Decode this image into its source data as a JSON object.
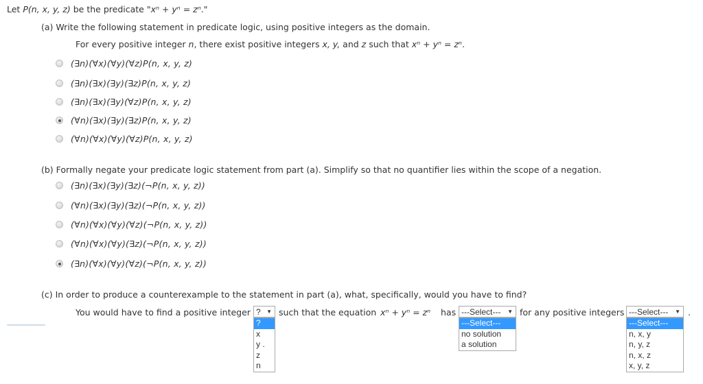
{
  "intro": {
    "prefix": "Let ",
    "predicate": "P(n, x, y, z)",
    "middle": " be the predicate  \"",
    "equation": "xⁿ + yⁿ = zⁿ",
    "suffix": ".\""
  },
  "part_a": {
    "prompt": "(a) Write the following statement in predicate logic, using positive integers as the domain.",
    "statement_prefix": "For every positive integer ",
    "statement_n": "n",
    "statement_mid": ", there exist positive integers ",
    "statement_vars": "x, y,",
    "statement_and": " and ",
    "statement_z": "z",
    "statement_such": " such that  ",
    "statement_eq": "xⁿ + yⁿ = zⁿ",
    "statement_end": ".",
    "options": [
      {
        "text": "(∃n)(∀x)(∀y)(∀z)P(n, x, y, z)",
        "selected": false
      },
      {
        "text": "(∃n)(∃x)(∃y)(∃z)P(n, x, y, z)",
        "selected": false
      },
      {
        "text": "(∃n)(∃x)(∃y)(∀z)P(n, x, y, z)",
        "selected": false
      },
      {
        "text": "(∀n)(∃x)(∃y)(∃z)P(n, x, y, z)",
        "selected": true
      },
      {
        "text": "(∀n)(∀x)(∀y)(∀z)P(n, x, y, z)",
        "selected": false
      }
    ]
  },
  "part_b": {
    "prompt": "(b) Formally negate your predicate logic statement from part (a). Simplify so that no quantifier lies within the scope of a negation.",
    "options": [
      {
        "text": "(∃n)(∃x)(∃y)(∃z)(¬P(n, x, y, z))",
        "selected": false
      },
      {
        "text": "(∀n)(∃x)(∃y)(∃z)(¬P(n, x, y, z))",
        "selected": false
      },
      {
        "text": "(∀n)(∀x)(∀y)(∀z)(¬P(n, x, y, z))",
        "selected": false
      },
      {
        "text": "(∀n)(∀x)(∀y)(∃z)(¬P(n, x, y, z))",
        "selected": false
      },
      {
        "text": "(∃n)(∀x)(∀y)(∀z)(¬P(n, x, y, z))",
        "selected": true
      }
    ]
  },
  "part_c": {
    "prompt": "(c) In order to produce a counterexample to the statement in part (a), what, specifically, would you have to find?",
    "sentence_1": "You would have to find a positive integer",
    "sentence_2": "such that the equation",
    "equation": "xⁿ + yⁿ = zⁿ",
    "sentence_3": "has",
    "sentence_4": "for any positive integers",
    "sentence_end": ".",
    "select_1": {
      "value": "?",
      "options": [
        "?",
        "x",
        "y",
        "z",
        "n"
      ],
      "highlighted": 0,
      "stray_char": "."
    },
    "select_2": {
      "value": "---Select---",
      "options": [
        "---Select---",
        "no solution",
        "a solution"
      ],
      "highlighted": 0
    },
    "select_3": {
      "value": "---Select---",
      "options": [
        "---Select---",
        "n, x, y",
        "n, y, z",
        "n, x, z",
        "x, y, z"
      ],
      "highlighted": 0
    },
    "arrow_glyph": "▼"
  }
}
